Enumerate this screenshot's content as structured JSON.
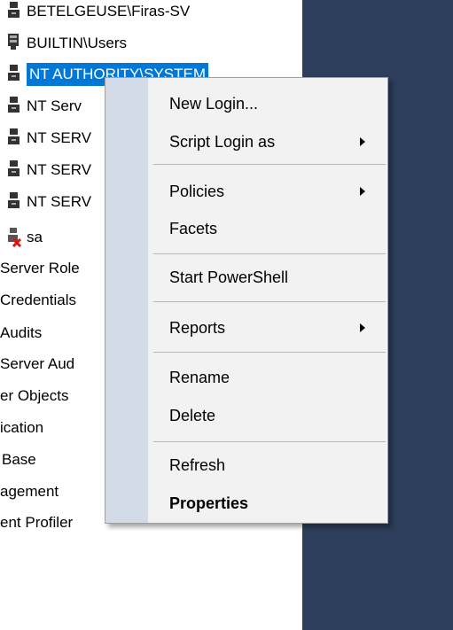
{
  "tree": {
    "items": [
      {
        "label": "BETELGEUSE\\Firas-SV",
        "icon": "login-user-icon"
      },
      {
        "label": "BUILTIN\\Users",
        "icon": "login-group-icon"
      },
      {
        "label": "NT AUTHORITY\\SYSTEM",
        "icon": "login-user-icon",
        "selected": true
      },
      {
        "label": "NT Serv",
        "icon": "login-user-icon"
      },
      {
        "label": "NT SERV",
        "icon": "login-user-icon"
      },
      {
        "label": "NT SERV",
        "icon": "login-user-icon"
      },
      {
        "label": "NT SERV",
        "icon": "login-user-icon"
      },
      {
        "label": "sa",
        "icon": "login-disabled-icon"
      },
      {
        "label": "Server Role"
      },
      {
        "label": "Credentials"
      },
      {
        "label": "Audits"
      },
      {
        "label": "Server Aud"
      },
      {
        "label": "er Objects"
      },
      {
        "label": "ication"
      },
      {
        "label": "Base"
      },
      {
        "label": "agement"
      },
      {
        "label": "ent Profiler"
      }
    ]
  },
  "context_menu": {
    "items": [
      {
        "label": "New Login..."
      },
      {
        "label": "Script Login as",
        "submenu": true
      },
      {
        "label": "Policies",
        "submenu": true
      },
      {
        "label": "Facets"
      },
      {
        "label": "Start PowerShell"
      },
      {
        "label": "Reports",
        "submenu": true
      },
      {
        "label": "Rename"
      },
      {
        "label": "Delete"
      },
      {
        "label": "Refresh"
      },
      {
        "label": "Properties",
        "bold": true
      }
    ]
  },
  "colors": {
    "selection": "#0078d7",
    "dark_pane": "#2d3e5c",
    "menu_background": "#f2f2f2",
    "menu_gutter": "#d3dae8"
  }
}
